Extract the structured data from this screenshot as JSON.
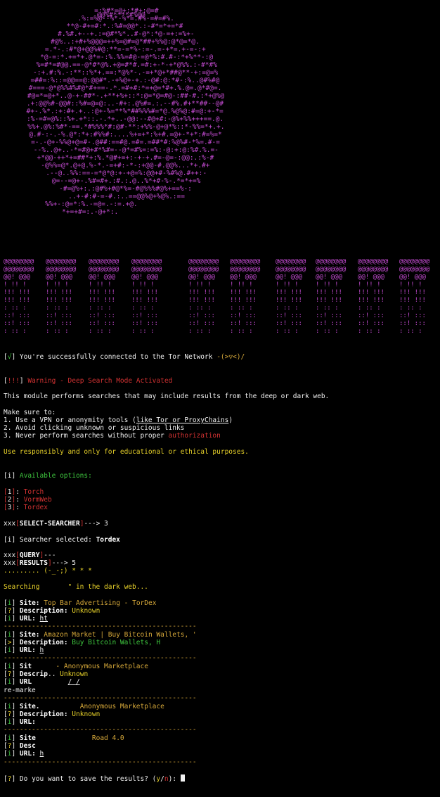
{
  "colors": {
    "art": "#c34bd1",
    "success": "#3ec63e",
    "warn": "#d23232",
    "notice": "#e8d22a",
    "accent": "#d7a93a"
  },
  "art_top": "@@%#****#%@@",
  "banner_text": "DARKSEARCH",
  "tor": {
    "check": "√",
    "text": "You're successfully connected to the Tor Network ",
    "face": "-(>▽<)/"
  },
  "warning": {
    "flag": "!!!",
    "title": "Warning - Deep Search Mode Activated"
  },
  "module_text": "This module performs searches that may include results from the deep or dark web.",
  "make_sure": "Make sure to:",
  "tips": [
    {
      "pre": "1. Use a VPN or anonymity tools (",
      "link": "like Tor or ProxyChains",
      "post": ")"
    },
    {
      "pre": "2. Avoid clicking unknown or suspicious links",
      "link": "",
      "post": ""
    },
    {
      "pre": "3. Never perform searches without proper ",
      "link": "",
      "post": "authorization"
    }
  ],
  "responsible": "Use responsibly and only for educational or ethical purposes.",
  "options_header": "Available options:",
  "options": [
    {
      "num": "1",
      "name": "Torch"
    },
    {
      "num": "2",
      "name": "VormWeb"
    },
    {
      "num": "3",
      "name": "Tordex"
    }
  ],
  "prompt_prefix": "xxx",
  "select_label": "SELECT-SEARCHER",
  "select_arrow": "---> 3",
  "searcher_label": "Searcher selected: ",
  "searcher_value": "Tordex",
  "query_label": "QUERY",
  "query_tail": "---",
  "results_label": "RESULTS",
  "results_tail": "---> 5",
  "dots_line": "......... (-_-;) * * *",
  "searching": "Searching       \" in the dark web...",
  "results": [
    {
      "site": "Top Bar Advertising - TorDex",
      "desc": "Unknown",
      "url": "ht",
      "desc_color": "notice"
    },
    {
      "site": "Amazon Market | Buy Bitcoin Wallets, '",
      "desc": "Buy Bitcoin Wallets, H",
      "url": "h",
      "desc_color": "success"
    },
    {
      "site": "- Anonymous Marketplace",
      "desc": "Unknown",
      "url": "/ /",
      "desc_color": "notice"
    },
    {
      "site": "Anonymous Marketplace",
      "desc": "Unknown",
      "url": "",
      "desc_color": "notice"
    },
    {
      "site": "Road 4.0",
      "desc": "",
      "url": "h",
      "desc_color": "notice"
    }
  ],
  "labels": {
    "site": "Site:",
    "desc": "Description:",
    "url": "URL:",
    "i": "i",
    "q": "?"
  },
  "extra_text": "re-marke",
  "separator": "------------------------------------------------",
  "save_prompt": "Do you want to save the results? (",
  "save_y": "y",
  "save_slash": "/",
  "save_n": "n",
  "save_end": "): "
}
